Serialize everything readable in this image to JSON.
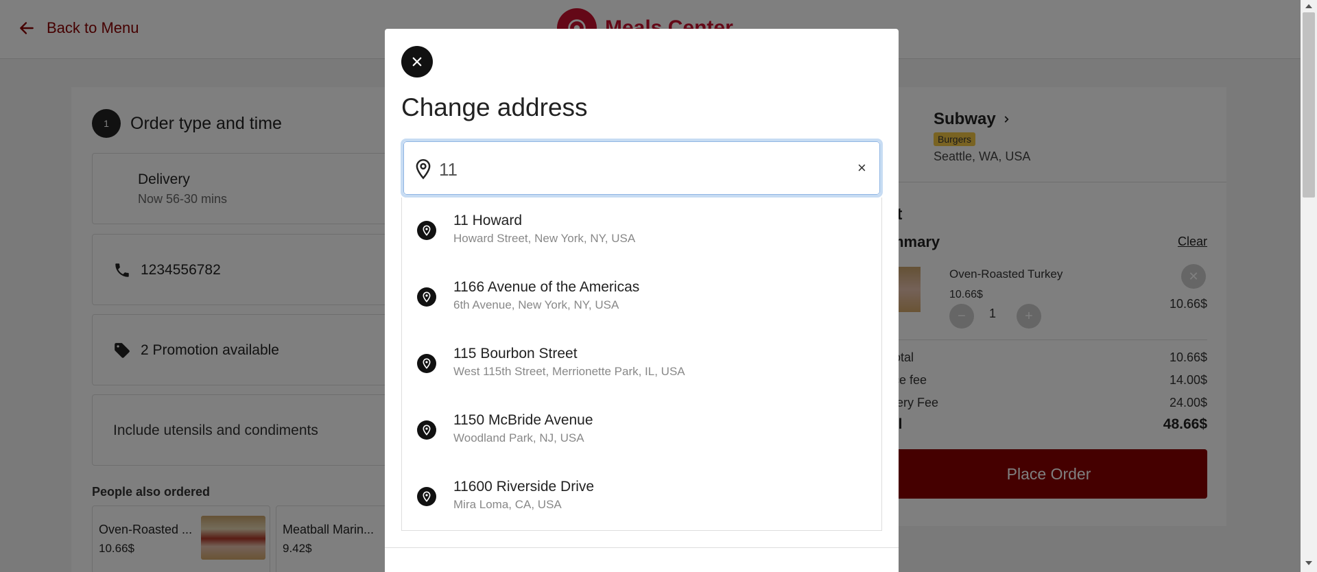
{
  "header": {
    "back_label": "Back to Menu",
    "brand_name": "Meals Center"
  },
  "order": {
    "step_number": "1",
    "step_title": "Order type and time",
    "delivery_title": "Delivery",
    "delivery_subtitle": "Now 56-30 mins",
    "phone": "1234556782",
    "promotion_count": "2",
    "promotion_label": "Promotion available",
    "utensils_label": "Include utensils and condiments"
  },
  "people_also_ordered": {
    "heading": "People also ordered",
    "items": [
      {
        "name": "Oven-Roasted ...",
        "price": "10.66$"
      },
      {
        "name": "Meatball Marin...",
        "price": "9.42$"
      }
    ]
  },
  "store": {
    "name": "Subway",
    "tag": "Burgers",
    "location": "Seattle, WA, USA"
  },
  "cart": {
    "heading": "rt",
    "summary_heading": "mmary",
    "clear_label": "Clear",
    "item": {
      "name": "Oven-Roasted Turkey",
      "unit_price": "10.66$",
      "quantity": "1",
      "total": "10.66$"
    },
    "rows": [
      {
        "label": "total",
        "value": "10.66$"
      },
      {
        "label": "ice fee",
        "value": "14.00$"
      },
      {
        "label": "very Fee",
        "value": "24.00$"
      }
    ],
    "total_label": "al",
    "total_value": "48.66$",
    "place_order_label": "Place Order"
  },
  "modal": {
    "title": "Change address",
    "search_value": "11",
    "clear_glyph": "×",
    "suggestions": [
      {
        "name": "11 Howard",
        "address": "Howard Street, New York, NY, USA"
      },
      {
        "name": "1166 Avenue of the Americas",
        "address": "6th Avenue, New York, NY, USA"
      },
      {
        "name": "115 Bourbon Street",
        "address": "West 115th Street, Merrionette Park, IL, USA"
      },
      {
        "name": "1150 McBride Avenue",
        "address": "Woodland Park, NJ, USA"
      },
      {
        "name": "11600 Riverside Drive",
        "address": "Mira Loma, CA, USA"
      }
    ]
  },
  "colors": {
    "brand_red": "#c8102e",
    "dark_red": "#8b0000",
    "tag_yellow": "#f3c744"
  }
}
